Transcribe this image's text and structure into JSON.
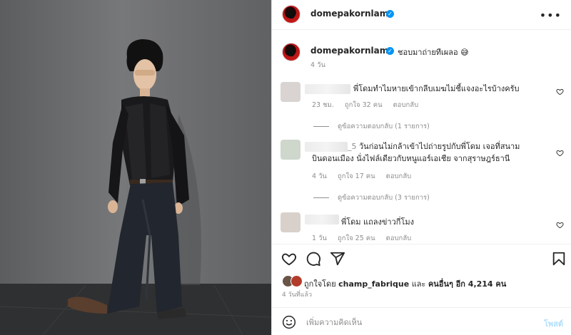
{
  "post": {
    "username": "domepakornlam",
    "caption": "ชอบมาถ่ายทีเผลอ 😅",
    "caption_time": "4 วัน"
  },
  "comments": [
    {
      "text": "พี่โดมทำไมหายเข้ากลีบเมฆไม่ชี้แจงอะไรบ้างครับ",
      "time": "23 ชม.",
      "likes": "ถูกใจ 32 คน",
      "reply_label": "ตอบกลับ",
      "view_replies": "ดูข้อความตอบกลับ (1 รายการ)"
    },
    {
      "prefix": "_5",
      "text_line1": "วันก่อนไม่กล้าเข้าไปถ่ายรูปกับพี่โดม เจอที่สนาม",
      "text_line2": "บินดอนเมือง นั่งไฟล์เดียวกับหนูแอร์เอเชีย จากสุราษฎร์ธานี",
      "time": "4 วัน",
      "likes": "ถูกใจ 17 คน",
      "reply_label": "ตอบกลับ",
      "view_replies": "ดูข้อความตอบกลับ (3 รายการ)"
    },
    {
      "text": "พี่โดม แถลงข่าวกี่โมง",
      "time": "1 วัน",
      "likes": "ถูกใจ 25 คน",
      "reply_label": "ตอบกลับ"
    }
  ],
  "likes_info": {
    "prefix": "ถูกใจโดย",
    "user": "champ_fabrique",
    "middle": "และ",
    "others": "คนอื่นๆ อีก 4,214 คน"
  },
  "post_time": "4 วันที่แล้ว",
  "add_comment": {
    "placeholder": "เพิ่มความคิดเห็น",
    "post_label": "โพสต์"
  },
  "icons": {
    "like": "heart-icon",
    "comment": "comment-icon",
    "share": "share-icon",
    "save": "bookmark-icon",
    "more": "more-options-icon",
    "emoji": "emoji-icon",
    "verified": "verified-badge-icon"
  },
  "colors": {
    "verified": "#0095f6",
    "post_button_disabled": "#b2dffc",
    "muted_text": "#8e8e8e"
  }
}
